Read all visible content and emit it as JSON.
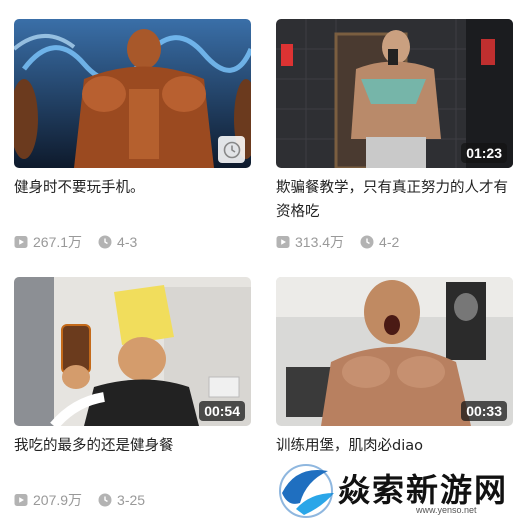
{
  "videos": [
    {
      "title": "健身时不要玩手机。",
      "views": "267.1万",
      "comments": "4-3",
      "duration": "",
      "badge_icon": "watch-later-icon"
    },
    {
      "title": "欺骗餐教学，只有真正努力的人才有资格吃",
      "views": "313.4万",
      "comments": "4-2",
      "duration": "01:23"
    },
    {
      "title": "我吃的最多的还是健身餐",
      "views": "207.9万",
      "comments": "3-25",
      "duration": "00:54"
    },
    {
      "title": "训练用堡，肌肉必diao",
      "views": "",
      "comments": "",
      "duration": "00:33"
    }
  ],
  "watermark": {
    "text": "焱索新游网",
    "url": "www.yenso.net"
  },
  "colors": {
    "meta_icon": "#b3b3b3",
    "title": "#222222",
    "meta_text": "#999999"
  }
}
